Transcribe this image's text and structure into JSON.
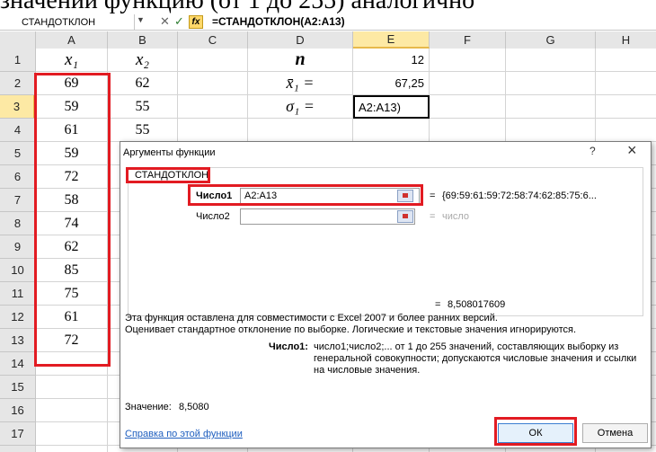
{
  "caption": {
    "text": "значений функцию (от 1 до 255) аналогично"
  },
  "formula_bar": {
    "name_box": "СТАНДОТКЛОН",
    "fx_icon": "fx",
    "formula": "=СТАНДОТКЛОН(A2:A13)"
  },
  "columns": [
    "A",
    "B",
    "C",
    "D",
    "E",
    "F",
    "G",
    "H"
  ],
  "rows": [
    "1",
    "2",
    "3",
    "4",
    "5",
    "6",
    "7",
    "8",
    "9",
    "10",
    "11",
    "12",
    "13",
    "14",
    "15",
    "16",
    "17"
  ],
  "col_a": {
    "header": "x₁",
    "values": [
      "69",
      "59",
      "61",
      "59",
      "72",
      "58",
      "74",
      "62",
      "85",
      "75",
      "61",
      "72"
    ]
  },
  "col_b": {
    "header": "x₂",
    "values": [
      "62",
      "55",
      "55"
    ]
  },
  "col_d": [
    "n",
    "x̄₁ =",
    "σ₁ ="
  ],
  "col_e": [
    "12",
    "67,25",
    "A2:A13)"
  ],
  "dialog": {
    "title": "Аргументы функции",
    "help_char": "?",
    "close_char": "×",
    "func_name": "СТАНДОТКЛОН",
    "arg1_label": "Число1",
    "arg1_value": "A2:A13",
    "arg1_result": "{69:59:61:59:72:58:74:62:85:75:6...",
    "arg2_label": "Число2",
    "arg2_result": "число",
    "eq": "=",
    "total_result": "8,508017609",
    "desc1": "Эта функция оставлена для совместимости с Excel 2007 и более ранних версий.",
    "desc2": "Оценивает стандартное отклонение по выборке. Логические и текстовые значения игнорируются.",
    "arg_help_label": "Число1:",
    "arg_help": "число1;число2;... от 1 до 255 значений, составляющих выборку из генеральной совокупности; допускаются числовые значения и ссылки на числовые значения.",
    "value_label": "Значение:",
    "value": "8,5080",
    "help_link": "Справка по этой функции",
    "ok": "ОК",
    "cancel": "Отмена"
  }
}
